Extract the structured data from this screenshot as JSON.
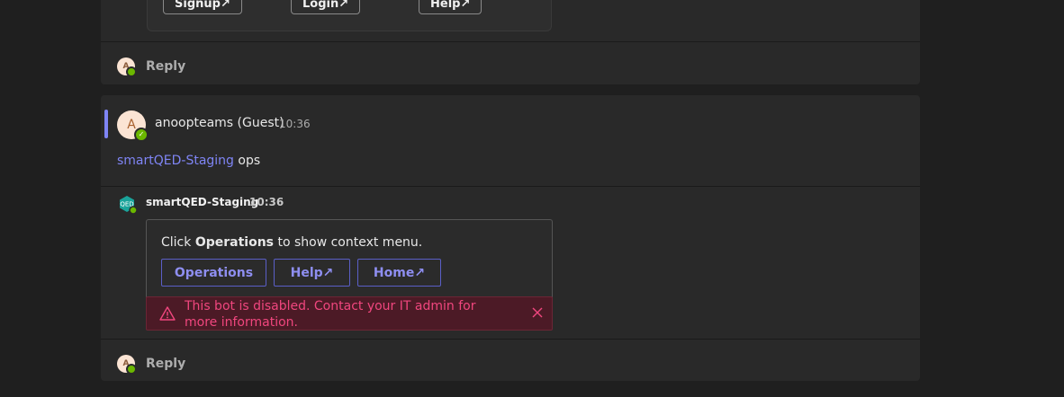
{
  "thread1": {
    "buttons": [
      "Signup↗",
      "Login↗",
      "Help↗"
    ],
    "reply_label": "Reply",
    "avatar_initial": "A"
  },
  "thread2": {
    "avatar_initial": "A",
    "author": "anoopteams (Guest)",
    "time": "10:36",
    "message": {
      "mention": "smartQED-Staging",
      "text": " ops"
    },
    "bot": {
      "name": "smartQED-Staging",
      "time": "10:36",
      "card": {
        "text_prefix": "Click ",
        "text_bold": "Operations",
        "text_suffix": " to show context menu.",
        "buttons": [
          "Operations",
          "Help↗",
          "Home↗"
        ]
      },
      "error": "This bot is disabled. Contact your IT admin for more information."
    },
    "reply_label": "Reply",
    "reply_avatar_initial": "A"
  },
  "colors": {
    "accent": "#7f85f5",
    "error_text": "#f0467e",
    "error_bg": "#4c1a26",
    "presence": "#6bb700"
  }
}
